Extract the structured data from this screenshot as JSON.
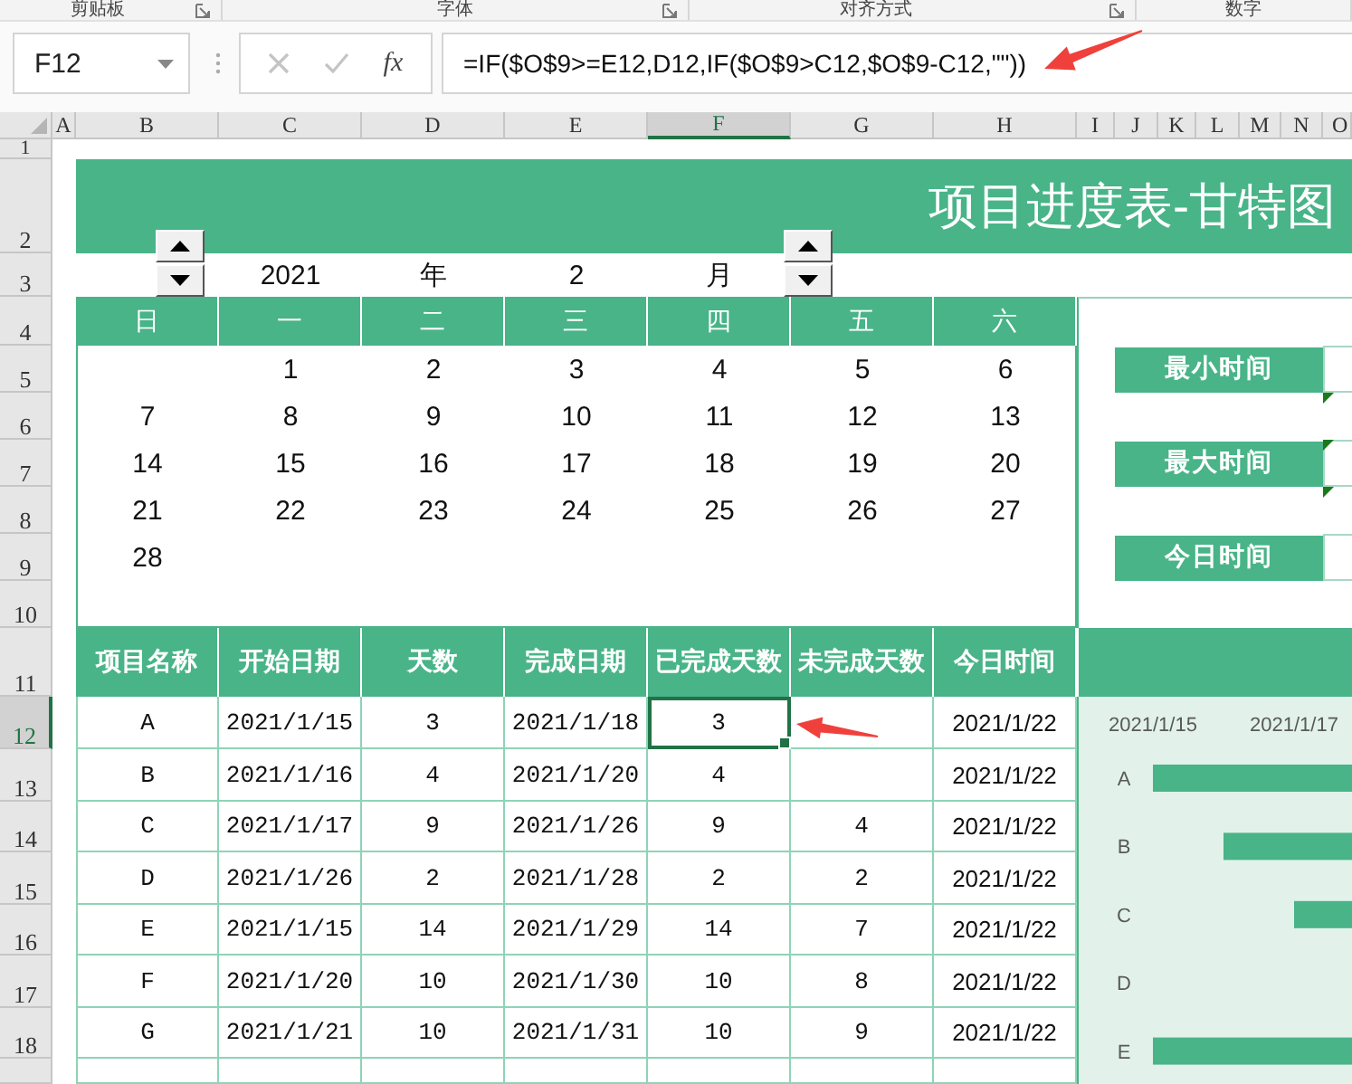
{
  "ribbon": {
    "groups": [
      {
        "label": "剪贴板",
        "launcher": true
      },
      {
        "label": "字体",
        "launcher": true
      },
      {
        "label": "对齐方式",
        "launcher": true
      },
      {
        "label": "数字",
        "launcher": false
      }
    ]
  },
  "formula_bar": {
    "name_box": "F12",
    "function_label": "fx",
    "formula": "=IF($O$9>=E12,D12,IF($O$9>C12,$O$9-C12,\"\"))"
  },
  "column_headers": [
    {
      "label": "A",
      "selected": false
    },
    {
      "label": "B",
      "selected": false
    },
    {
      "label": "C",
      "selected": false
    },
    {
      "label": "D",
      "selected": false
    },
    {
      "label": "E",
      "selected": false
    },
    {
      "label": "F",
      "selected": true
    },
    {
      "label": "G",
      "selected": false
    },
    {
      "label": "H",
      "selected": false
    },
    {
      "label": "I",
      "selected": false
    },
    {
      "label": "J",
      "selected": false
    },
    {
      "label": "K",
      "selected": false
    },
    {
      "label": "L",
      "selected": false
    },
    {
      "label": "M",
      "selected": false
    },
    {
      "label": "N",
      "selected": false
    },
    {
      "label": "O",
      "selected": false
    }
  ],
  "row_headers": [
    {
      "label": "1",
      "selected": false
    },
    {
      "label": "2",
      "selected": false
    },
    {
      "label": "3",
      "selected": false
    },
    {
      "label": "4",
      "selected": false
    },
    {
      "label": "5",
      "selected": false
    },
    {
      "label": "6",
      "selected": false
    },
    {
      "label": "7",
      "selected": false
    },
    {
      "label": "8",
      "selected": false
    },
    {
      "label": "9",
      "selected": false
    },
    {
      "label": "10",
      "selected": false
    },
    {
      "label": "11",
      "selected": false
    },
    {
      "label": "12",
      "selected": true
    },
    {
      "label": "13",
      "selected": false
    },
    {
      "label": "14",
      "selected": false
    },
    {
      "label": "15",
      "selected": false
    },
    {
      "label": "16",
      "selected": false
    },
    {
      "label": "17",
      "selected": false
    },
    {
      "label": "18",
      "selected": false
    }
  ],
  "title": "项目进度表-甘特图",
  "date_picker": {
    "year": "2021",
    "year_unit": "年",
    "month": "2",
    "month_unit": "月"
  },
  "calendar": {
    "weekdays": [
      "日",
      "一",
      "二",
      "三",
      "四",
      "五",
      "六"
    ],
    "weeks": [
      [
        "1",
        "2",
        "3",
        "4",
        "5",
        "6"
      ],
      [
        "7",
        "8",
        "9",
        "10",
        "11",
        "12",
        "13"
      ],
      [
        "14",
        "15",
        "16",
        "17",
        "18",
        "19",
        "20"
      ],
      [
        "21",
        "22",
        "23",
        "24",
        "25",
        "26",
        "27"
      ],
      [
        "28"
      ]
    ]
  },
  "side_panel": {
    "rows": [
      {
        "kind": "field",
        "label": "最小时间",
        "error_mark": false
      },
      {
        "kind": "gap",
        "error_mark": true
      },
      {
        "kind": "field",
        "label": "最大时间",
        "error_mark": true
      },
      {
        "kind": "gap",
        "error_mark": true
      },
      {
        "kind": "field",
        "label": "今日时间",
        "error_mark": false
      }
    ]
  },
  "table": {
    "columns": [
      "项目名称",
      "开始日期",
      "天数",
      "完成日期",
      "已完成天数",
      "未完成天数",
      "今日时间"
    ],
    "rows": [
      {
        "cells": [
          {
            "text": "A",
            "selected": false
          },
          {
            "text": "2021/1/15",
            "selected": false
          },
          {
            "text": "3",
            "selected": false
          },
          {
            "text": "2021/1/18",
            "selected": false
          },
          {
            "text": "3",
            "selected": true
          },
          {
            "selected": false
          },
          {
            "text": "2021/1/22",
            "selected": false
          }
        ]
      },
      {
        "cells": [
          {
            "text": "B",
            "selected": false
          },
          {
            "text": "2021/1/16",
            "selected": false
          },
          {
            "text": "4",
            "selected": false
          },
          {
            "text": "2021/1/20",
            "selected": false
          },
          {
            "text": "4",
            "selected": false
          },
          {
            "selected": false
          },
          {
            "text": "2021/1/22",
            "selected": false
          }
        ]
      },
      {
        "cells": [
          {
            "text": "C",
            "selected": false
          },
          {
            "text": "2021/1/17",
            "selected": false
          },
          {
            "text": "9",
            "selected": false
          },
          {
            "text": "2021/1/26",
            "selected": false
          },
          {
            "text": "9",
            "selected": false
          },
          {
            "text": "4",
            "selected": false
          },
          {
            "text": "2021/1/22",
            "selected": false
          }
        ]
      },
      {
        "cells": [
          {
            "text": "D",
            "selected": false
          },
          {
            "text": "2021/1/26",
            "selected": false
          },
          {
            "text": "2",
            "selected": false
          },
          {
            "text": "2021/1/28",
            "selected": false
          },
          {
            "text": "2",
            "selected": false
          },
          {
            "text": "2",
            "selected": false
          },
          {
            "text": "2021/1/22",
            "selected": false
          }
        ]
      },
      {
        "cells": [
          {
            "text": "E",
            "selected": false
          },
          {
            "text": "2021/1/15",
            "selected": false
          },
          {
            "text": "14",
            "selected": false
          },
          {
            "text": "2021/1/29",
            "selected": false
          },
          {
            "text": "14",
            "selected": false
          },
          {
            "text": "7",
            "selected": false
          },
          {
            "text": "2021/1/22",
            "selected": false
          }
        ]
      },
      {
        "cells": [
          {
            "text": "F",
            "selected": false
          },
          {
            "text": "2021/1/20",
            "selected": false
          },
          {
            "text": "10",
            "selected": false
          },
          {
            "text": "2021/1/30",
            "selected": false
          },
          {
            "text": "10",
            "selected": false
          },
          {
            "text": "8",
            "selected": false
          },
          {
            "text": "2021/1/22",
            "selected": false
          }
        ]
      },
      {
        "cells": [
          {
            "text": "G",
            "selected": false
          },
          {
            "text": "2021/1/21",
            "selected": false
          },
          {
            "text": "10",
            "selected": false
          },
          {
            "text": "2021/1/31",
            "selected": false
          },
          {
            "text": "10",
            "selected": false
          },
          {
            "text": "9",
            "selected": false
          },
          {
            "text": "2021/1/22",
            "selected": false
          }
        ]
      }
    ]
  },
  "gantt": {
    "date_ticks": [
      "2021/1/15",
      "2021/1/17"
    ],
    "tasks": [
      {
        "label": "A"
      },
      {
        "label": "B"
      },
      {
        "label": "C"
      },
      {
        "label": "D"
      },
      {
        "label": "E"
      }
    ]
  }
}
